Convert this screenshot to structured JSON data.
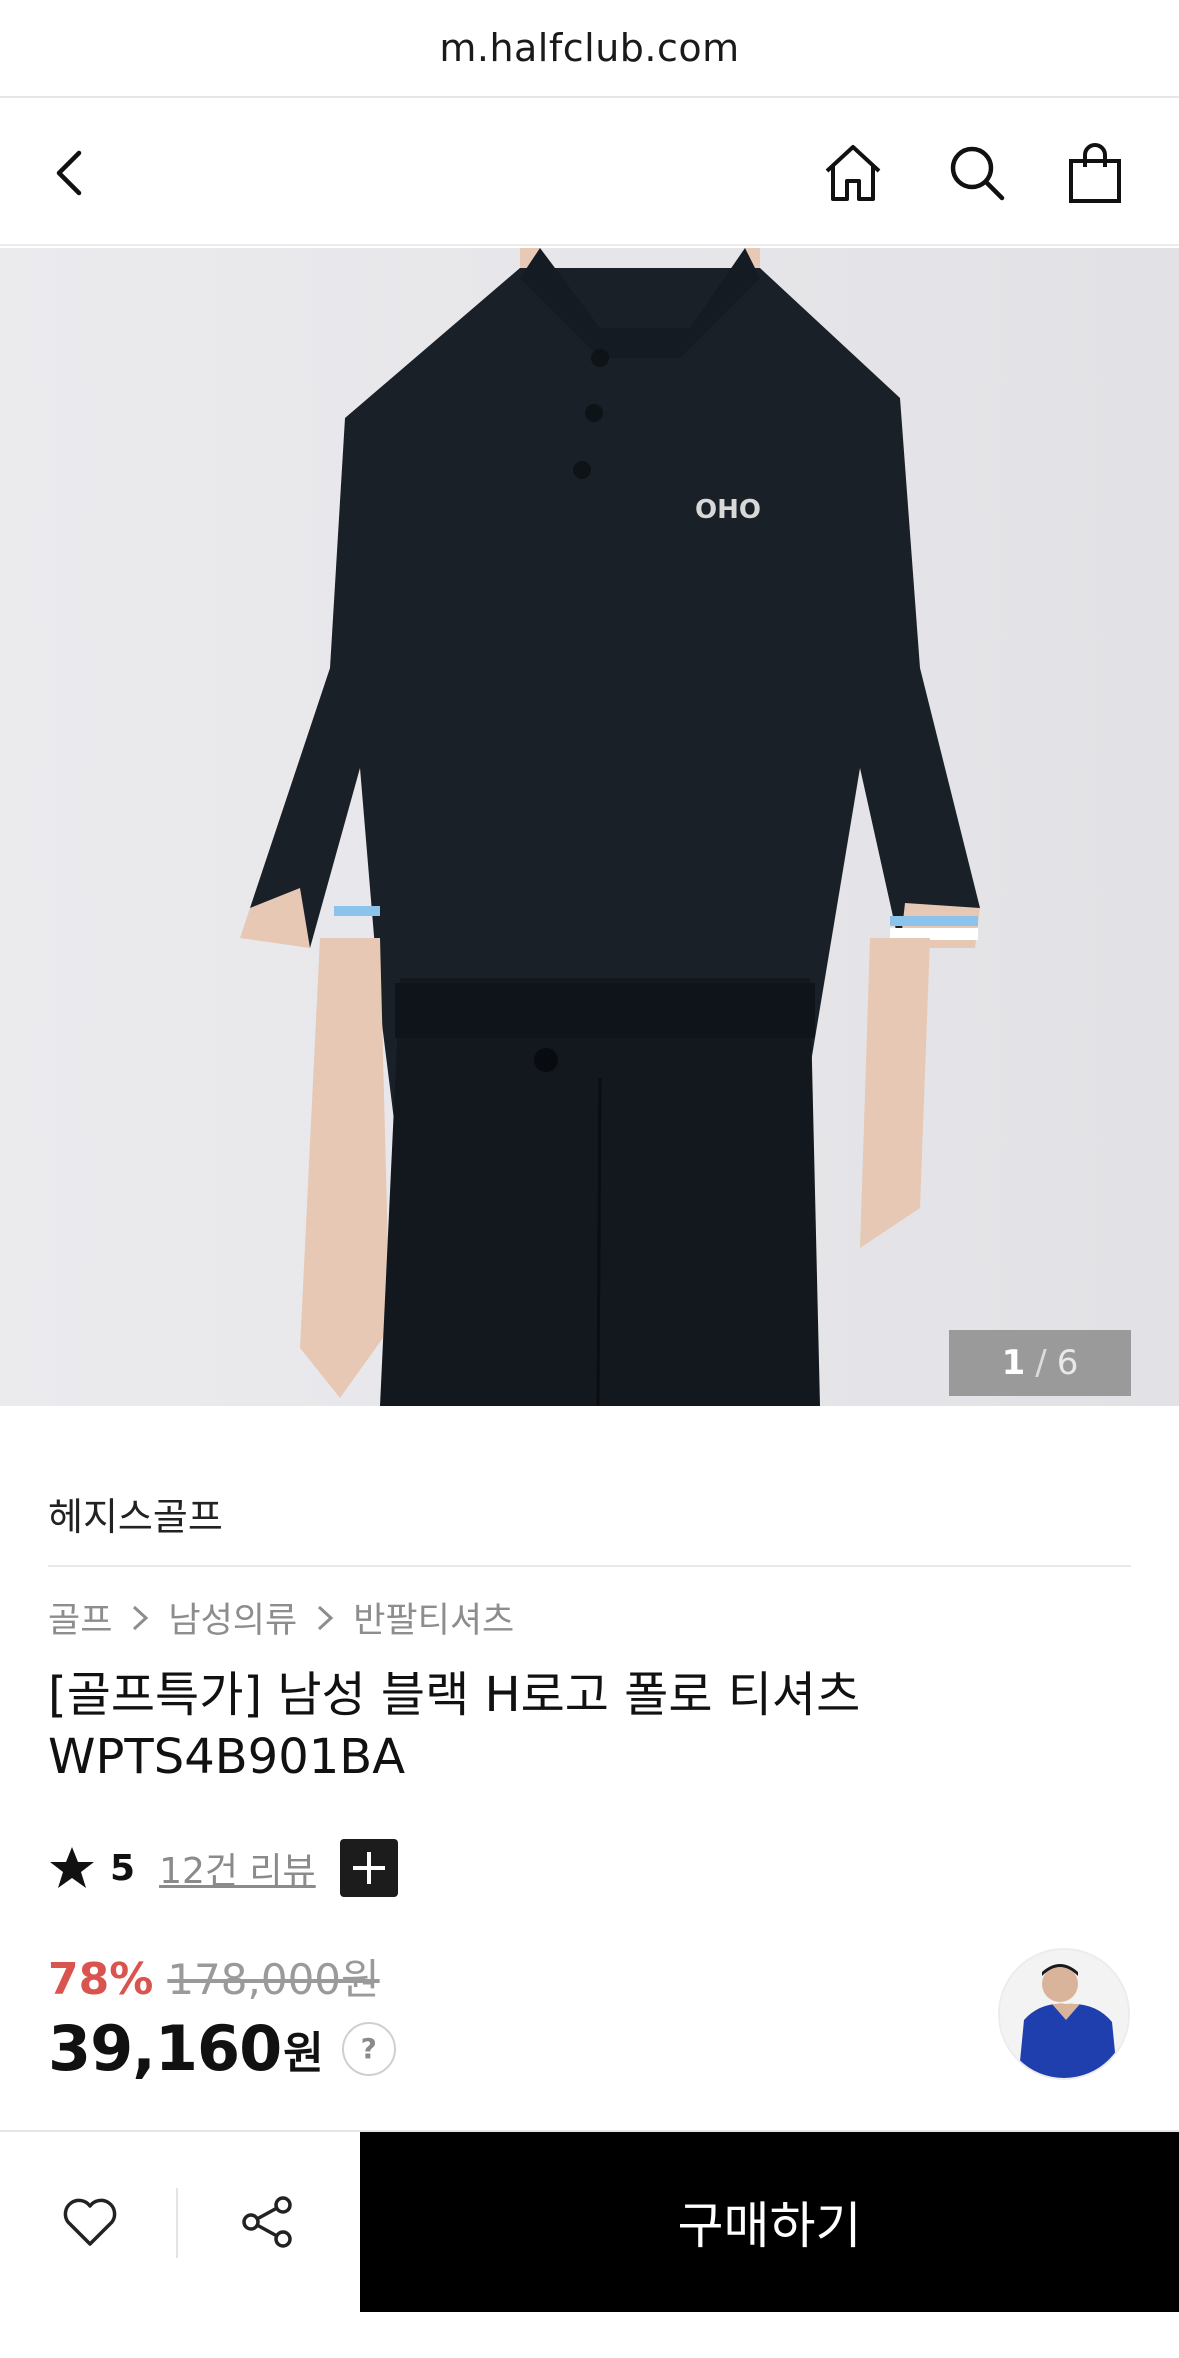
{
  "browser": {
    "url": "m.halfclub.com"
  },
  "header": {
    "back_icon": "chevron-left-icon",
    "home_icon": "home-icon",
    "search_icon": "search-icon",
    "cart_icon": "shopping-bag-icon"
  },
  "gallery": {
    "current": "1",
    "separator": "/",
    "total": "6"
  },
  "product": {
    "brand": "헤지스골프",
    "breadcrumb": [
      "골프",
      "남성의류",
      "반팔티셔츠"
    ],
    "title_line1": "[골프특가] 남성 블랙 H로고 폴로 티셔츠",
    "title_line2": "WPTS4B901BA",
    "rating": "5",
    "reviews": "12건 리뷰",
    "discount": "78%",
    "original_price": "178,000원",
    "price": "39,160",
    "price_unit": "원",
    "price_help": "?"
  },
  "bottom": {
    "buy_label": "구매하기",
    "like_icon": "heart-icon",
    "share_icon": "share-icon"
  },
  "colors": {
    "discount": "#d9534f",
    "buy_bg": "#000000",
    "counter_bg": "#9a9a9a"
  }
}
